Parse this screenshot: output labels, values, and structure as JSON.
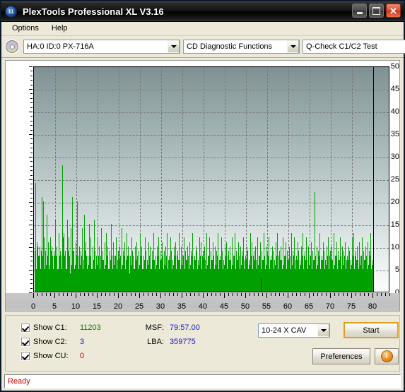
{
  "window": {
    "title": "PlexTools Professional XL V3.16",
    "logo_text": "XL",
    "logo_icon": "plextools-xl-logo-icon",
    "minimize_icon": "minimize-icon",
    "maximize_icon": "maximize-icon",
    "close_icon": "close-icon"
  },
  "menubar": {
    "items": [
      {
        "label": "Options"
      },
      {
        "label": "Help"
      }
    ]
  },
  "toolbar": {
    "disc_icon": "cd-disc-icon",
    "drive_select": {
      "value": "HA:0 ID:0  PX-716A",
      "arrow_icon": "chevron-down-icon"
    },
    "function_select": {
      "value": "CD Diagnostic Functions",
      "arrow_icon": "chevron-down-icon"
    },
    "test_select": {
      "value": "Q-Check C1/C2 Test",
      "arrow_icon": "chevron-down-icon"
    }
  },
  "controls": {
    "checkboxes": [
      {
        "label": "Show C1:",
        "checked": true,
        "value": "11203",
        "color": "#008000"
      },
      {
        "label": "Show C2:",
        "checked": true,
        "value": "3",
        "color": "#1b1bc8"
      },
      {
        "label": "Show CU:",
        "checked": true,
        "value": "0",
        "color": "#d00000"
      }
    ],
    "info": [
      {
        "key": "MSF:",
        "value": "79:57.00"
      },
      {
        "key": "LBA:",
        "value": "359775"
      }
    ],
    "speed_select": {
      "value": "10-24 X CAV",
      "arrow_icon": "chevron-down-icon"
    },
    "start_button": "Start",
    "preferences_button": "Preferences",
    "info_button_icon": "info-circle-icon",
    "info_button_glyph": "i"
  },
  "statusbar": {
    "text": "Ready"
  },
  "chart_data": {
    "type": "bar",
    "title": "",
    "xlabel": "",
    "ylabel": "",
    "xlim": [
      0,
      84
    ],
    "ylim": [
      0,
      50
    ],
    "xticks": [
      0,
      5,
      10,
      15,
      20,
      25,
      30,
      35,
      40,
      45,
      50,
      55,
      60,
      65,
      70,
      75,
      80
    ],
    "yticks": [
      0,
      5,
      10,
      15,
      20,
      25,
      30,
      35,
      40,
      45,
      50
    ],
    "grid": true,
    "data_end_x": 80,
    "legend_position": "bottom-panel",
    "colors": {
      "c1": "#00a000",
      "c2": "#1b1bc8",
      "cu": "#d00000"
    },
    "series": [
      {
        "name": "C1",
        "color": "#00a000",
        "totals": 11203,
        "x": [
          0.2,
          0.4,
          0.6,
          0.8,
          1.0,
          1.2,
          1.4,
          1.6,
          1.8,
          2.0,
          2.2,
          2.4,
          2.6,
          2.8,
          3.0,
          3.2,
          3.4,
          3.6,
          3.8,
          4.0,
          4.2,
          4.4,
          4.6,
          4.8,
          5.0,
          5.2,
          5.4,
          5.6,
          5.8,
          6.0,
          6.2,
          6.4,
          6.6,
          6.8,
          7.0,
          7.2,
          7.4,
          7.6,
          7.8,
          8.0,
          8.2,
          8.4,
          8.6,
          8.8,
          9.0,
          9.2,
          9.4,
          9.6,
          9.8,
          10.0,
          10.2,
          10.4,
          10.6,
          10.8,
          11.0,
          11.2,
          11.4,
          11.6,
          11.8,
          12.0,
          12.2,
          12.4,
          12.6,
          12.8,
          13.0,
          13.2,
          13.4,
          13.6,
          13.8,
          14.0,
          14.2,
          14.4,
          14.6,
          14.8,
          15.0,
          15.2,
          15.4,
          15.6,
          15.8,
          16.0,
          16.2,
          16.4,
          16.6,
          16.8,
          17.0,
          17.2,
          17.4,
          17.6,
          17.8,
          18.0,
          18.2,
          18.4,
          18.6,
          18.8,
          19.0,
          19.2,
          19.4,
          19.6,
          19.8,
          20.0,
          20.2,
          20.4,
          20.6,
          20.8,
          21.0,
          21.2,
          21.4,
          21.6,
          21.8,
          22.0,
          22.2,
          22.4,
          22.6,
          22.8,
          23.0,
          23.2,
          23.4,
          23.6,
          23.8,
          24.0,
          24.2,
          24.4,
          24.6,
          24.8,
          25.0,
          25.2,
          25.4,
          25.6,
          25.8,
          26.0,
          26.2,
          26.4,
          26.6,
          26.8,
          27.0,
          27.2,
          27.4,
          27.6,
          27.8,
          28.0,
          28.2,
          28.4,
          28.6,
          28.8,
          29.0,
          29.2,
          29.4,
          29.6,
          29.8,
          30.0,
          30.2,
          30.4,
          30.6,
          30.8,
          31.0,
          31.2,
          31.4,
          31.6,
          31.8,
          32.0,
          32.2,
          32.4,
          32.6,
          32.8,
          33.0,
          33.2,
          33.4,
          33.6,
          33.8,
          34.0,
          34.2,
          34.4,
          34.6,
          34.8,
          35.0,
          35.2,
          35.4,
          35.6,
          35.8,
          36.0,
          36.2,
          36.4,
          36.6,
          36.8,
          37.0,
          37.2,
          37.4,
          37.6,
          37.8,
          38.0,
          38.2,
          38.4,
          38.6,
          38.8,
          39.0,
          39.2,
          39.4,
          39.6,
          39.8,
          40.0,
          40.2,
          40.4,
          40.6,
          40.8,
          41.0,
          41.2,
          41.4,
          41.6,
          41.8,
          42.0,
          42.2,
          42.4,
          42.6,
          42.8,
          43.0,
          43.2,
          43.4,
          43.6,
          43.8,
          44.0,
          44.2,
          44.4,
          44.6,
          44.8,
          45.0,
          45.2,
          45.4,
          45.6,
          45.8,
          46.0,
          46.2,
          46.4,
          46.6,
          46.8,
          47.0,
          47.2,
          47.4,
          47.6,
          47.8,
          48.0,
          48.2,
          48.4,
          48.6,
          48.8,
          49.0,
          49.2,
          49.4,
          49.6,
          49.8,
          50.0,
          50.2,
          50.4,
          50.6,
          50.8,
          51.0,
          51.2,
          51.4,
          51.6,
          51.8,
          52.0,
          52.2,
          52.4,
          52.6,
          52.8,
          53.0,
          53.2,
          53.4,
          53.6,
          53.8,
          54.0,
          54.2,
          54.4,
          54.6,
          54.8,
          55.0,
          55.2,
          55.4,
          55.6,
          55.8,
          56.0,
          56.2,
          56.4,
          56.6,
          56.8,
          57.0,
          57.2,
          57.4,
          57.6,
          57.8,
          58.0,
          58.2,
          58.4,
          58.6,
          58.8,
          59.0,
          59.2,
          59.4,
          59.6,
          59.8,
          60.0,
          60.2,
          60.4,
          60.6,
          60.8,
          61.0,
          61.2,
          61.4,
          61.6,
          61.8,
          62.0,
          62.2,
          62.4,
          62.6,
          62.8,
          63.0,
          63.2,
          63.4,
          63.6,
          63.8,
          64.0,
          64.2,
          64.4,
          64.6,
          64.8,
          65.0,
          65.2,
          65.4,
          65.6,
          65.8,
          66.0,
          66.2,
          66.4,
          66.6,
          66.8,
          67.0,
          67.2,
          67.4,
          67.6,
          67.8,
          68.0,
          68.2,
          68.4,
          68.6,
          68.8,
          69.0,
          69.2,
          69.4,
          69.6,
          69.8,
          70.0,
          70.2,
          70.4,
          70.6,
          70.8,
          71.0,
          71.2,
          71.4,
          71.6,
          71.8,
          72.0,
          72.2,
          72.4,
          72.6,
          72.8,
          73.0,
          73.2,
          73.4,
          73.6,
          73.8,
          74.0,
          74.2,
          74.4,
          74.6,
          74.8,
          75.0,
          75.2,
          75.4,
          75.6,
          75.8,
          76.0,
          76.2,
          76.4,
          76.6,
          76.8,
          77.0,
          77.2,
          77.4,
          77.6,
          77.8,
          78.0,
          78.2,
          78.4,
          78.6,
          78.8,
          79.0,
          79.2,
          79.4,
          79.6,
          79.8,
          80.0
        ],
        "values": [
          9,
          24,
          11,
          10,
          8,
          5,
          10,
          9,
          21,
          8,
          20,
          12,
          9,
          6,
          17,
          7,
          11,
          6,
          12,
          9,
          10,
          5,
          9,
          8,
          16,
          6,
          10,
          5,
          13,
          8,
          9,
          7,
          28,
          12,
          13,
          8,
          9,
          5,
          16,
          9,
          12,
          4,
          14,
          6,
          21,
          9,
          9,
          6,
          11,
          8,
          20,
          7,
          10,
          5,
          9,
          3,
          14,
          7,
          17,
          9,
          11,
          5,
          8,
          6,
          15,
          8,
          12,
          5,
          10,
          7,
          16,
          9,
          8,
          4,
          12,
          6,
          10,
          8,
          14,
          7,
          9,
          5,
          11,
          6,
          13,
          8,
          10,
          5,
          9,
          7,
          15,
          8,
          11,
          4,
          8,
          6,
          12,
          7,
          9,
          5,
          10,
          8,
          14,
          6,
          9,
          5,
          11,
          7,
          13,
          8,
          10,
          4,
          8,
          6,
          12,
          9,
          7,
          5,
          10,
          6,
          11,
          8,
          9,
          4,
          13,
          7,
          10,
          5,
          8,
          6,
          12,
          9,
          7,
          4,
          11,
          8,
          10,
          5,
          9,
          6,
          13,
          7,
          8,
          4,
          10,
          6,
          12,
          9,
          7,
          5,
          11,
          8,
          9,
          4,
          10,
          6,
          13,
          7,
          8,
          5,
          12,
          9,
          7,
          4,
          10,
          6,
          11,
          8,
          9,
          5,
          13,
          7,
          10,
          4,
          8,
          6,
          12,
          9,
          7,
          5,
          10,
          8,
          11,
          4,
          9,
          6,
          13,
          7,
          8,
          5,
          10,
          9,
          7,
          4,
          12,
          6,
          11,
          8,
          9,
          5,
          10,
          7,
          13,
          4,
          8,
          6,
          12,
          9,
          7,
          5,
          11,
          8,
          10,
          4,
          9,
          6,
          13,
          7,
          8,
          5,
          12,
          9,
          7,
          4,
          10,
          6,
          11,
          8,
          9,
          5,
          10,
          7,
          12,
          4,
          8,
          6,
          13,
          9,
          7,
          5,
          11,
          8,
          10,
          4,
          9,
          6,
          12,
          7,
          8,
          5,
          10,
          9,
          7,
          4,
          13,
          6,
          11,
          8,
          9,
          5,
          10,
          7,
          12,
          4,
          8,
          6,
          11,
          9,
          7,
          5,
          13,
          8,
          10,
          4,
          9,
          6,
          12,
          7,
          8,
          5,
          10,
          9,
          7,
          4,
          11,
          6,
          13,
          8,
          9,
          5,
          10,
          7,
          12,
          4,
          8,
          6,
          11,
          9,
          7,
          5,
          10,
          8,
          13,
          4,
          9,
          6,
          12,
          7,
          8,
          5,
          11,
          9,
          7,
          4,
          10,
          6,
          13,
          8,
          9,
          5,
          12,
          7,
          10,
          4,
          8,
          6,
          11,
          9,
          7,
          5,
          22,
          8,
          10,
          4,
          9,
          6,
          13,
          7,
          8,
          5,
          11,
          9,
          7,
          4,
          10,
          6,
          12,
          8,
          9,
          5,
          10,
          7,
          13,
          4,
          8,
          6,
          11,
          9,
          7,
          5,
          12,
          8,
          10,
          4,
          9,
          6,
          11,
          7,
          8,
          5,
          10,
          9,
          7,
          4,
          12,
          6,
          13,
          8,
          9,
          5,
          10,
          7,
          11,
          4,
          8,
          6,
          12,
          9,
          7,
          5,
          10,
          8,
          11,
          4,
          9,
          6,
          13,
          7
        ]
      },
      {
        "name": "C2",
        "color": "#1b1bc8",
        "totals": 3,
        "x": [
          53.5
        ],
        "values": [
          3
        ]
      },
      {
        "name": "CU",
        "color": "#d00000",
        "totals": 0,
        "x": [],
        "values": []
      }
    ]
  }
}
